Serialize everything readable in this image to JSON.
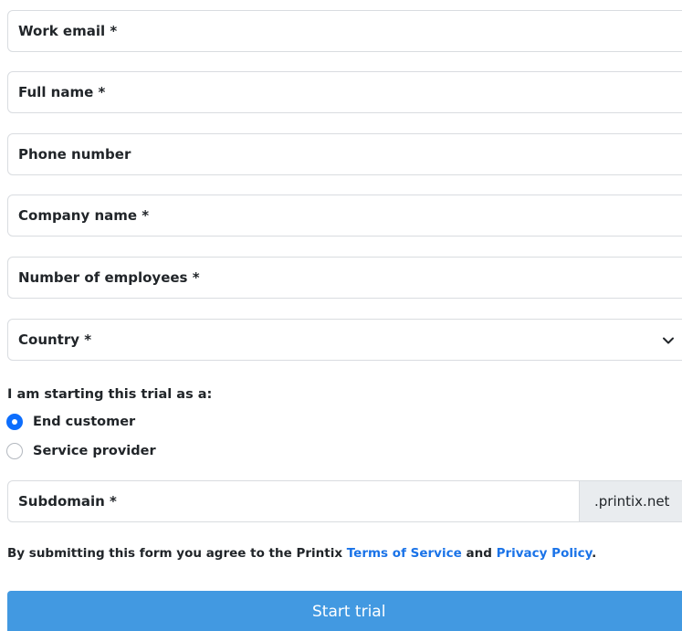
{
  "form": {
    "fields": [
      {
        "label": "Work email *"
      },
      {
        "label": "Full name *"
      },
      {
        "label": "Phone number"
      },
      {
        "label": "Company name *"
      },
      {
        "label": "Number of employees *"
      },
      {
        "label": "Country *",
        "type": "select"
      }
    ],
    "trial_question": "I am starting this trial as a:",
    "trial_options": [
      {
        "label": "End customer",
        "selected": true
      },
      {
        "label": "Service provider",
        "selected": false
      }
    ],
    "subdomain": {
      "label": "Subdomain *",
      "suffix": ".printix.net"
    },
    "terms": {
      "prefix": "By submitting this form you agree to the Printix",
      "terms_link": "Terms of Service",
      "middle": "and",
      "privacy_link": "Privacy Policy",
      "suffix": "."
    },
    "submit_label": "Start trial"
  },
  "colors": {
    "accent": "#0d6efd",
    "button": "#4299e1",
    "link": "#1a73e8"
  },
  "icons": {
    "country_select": "chevron-down-icon"
  }
}
